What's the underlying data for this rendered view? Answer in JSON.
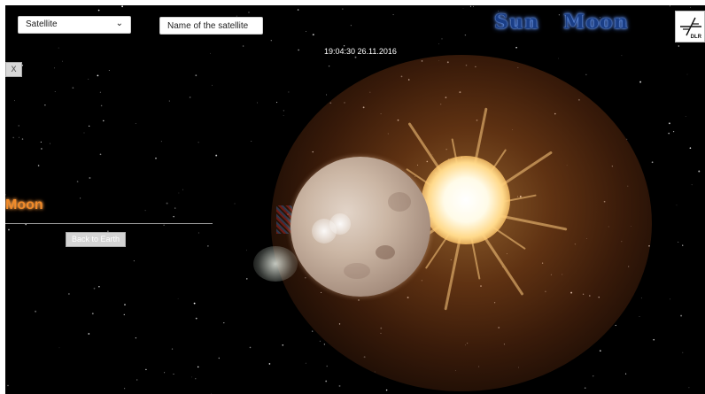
{
  "toolbar": {
    "select": {
      "selected": "Satellite"
    },
    "name_input": {
      "placeholder": "Name of the satellite",
      "value": ""
    },
    "links": {
      "sun": "Sun",
      "moon": "Moon"
    },
    "logo": {
      "label": "DLR",
      "icon": "dlr-logo-icon"
    }
  },
  "scene": {
    "timestamp": "19:04:30 26.11.2016"
  },
  "info_panel": {
    "close_label": "X",
    "title": "Moon",
    "back_button": "Back to Earth"
  },
  "colors": {
    "background": "#000000",
    "link_blue": "#1a3e86",
    "panel_title_orange": "#f08a2a",
    "button_gray": "#d4d4d4"
  }
}
